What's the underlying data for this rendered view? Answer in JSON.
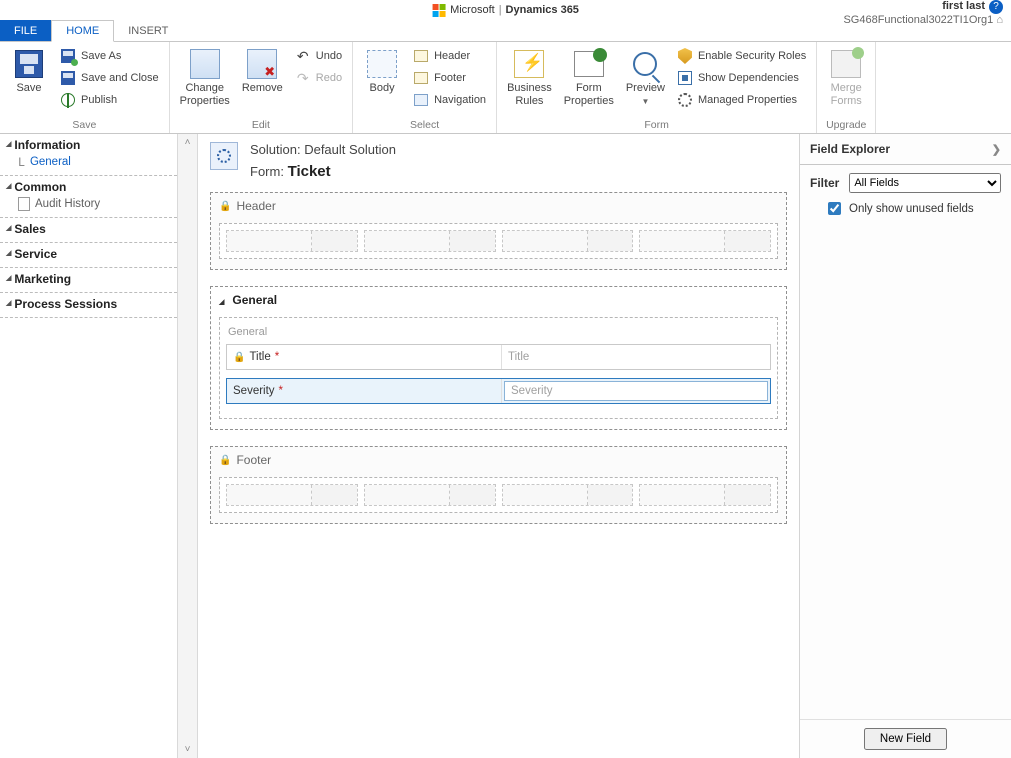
{
  "brand": {
    "company": "Microsoft",
    "product": "Dynamics 365"
  },
  "user": {
    "name": "first last",
    "org": "SG468Functional3022TI1Org1"
  },
  "menu": {
    "file": "FILE",
    "home": "HOME",
    "insert": "INSERT"
  },
  "ribbon": {
    "save": {
      "save": "Save",
      "save_as": "Save As",
      "save_close": "Save and Close",
      "publish": "Publish",
      "group": "Save"
    },
    "edit": {
      "change_props1": "Change",
      "change_props2": "Properties",
      "remove": "Remove",
      "undo": "Undo",
      "redo": "Redo",
      "group": "Edit"
    },
    "select": {
      "body": "Body",
      "header": "Header",
      "footer": "Footer",
      "navigation": "Navigation",
      "group": "Select"
    },
    "form": {
      "biz1": "Business",
      "biz2": "Rules",
      "props1": "Form",
      "props2": "Properties",
      "preview": "Preview",
      "sec": "Enable Security Roles",
      "dep": "Show Dependencies",
      "man": "Managed Properties",
      "group": "Form"
    },
    "upgrade": {
      "merge1": "Merge",
      "merge2": "Forms",
      "group": "Upgrade"
    }
  },
  "nav": {
    "information": "Information",
    "general": "General",
    "common": "Common",
    "audit": "Audit History",
    "sales": "Sales",
    "service": "Service",
    "marketing": "Marketing",
    "process": "Process Sessions"
  },
  "canvas": {
    "solution_prefix": "Solution: ",
    "solution_name": "Default Solution",
    "form_prefix": "Form: ",
    "form_name": "Ticket",
    "header": "Header",
    "footer": "Footer",
    "general_section": "General",
    "general_sub": "General",
    "title_label": "Title",
    "title_ph": "Title",
    "severity_label": "Severity",
    "severity_ph": "Severity"
  },
  "explorer": {
    "title": "Field Explorer",
    "filter_label": "Filter",
    "filter_value": "All Fields",
    "unused": "Only show unused fields",
    "new_field": "New Field"
  }
}
